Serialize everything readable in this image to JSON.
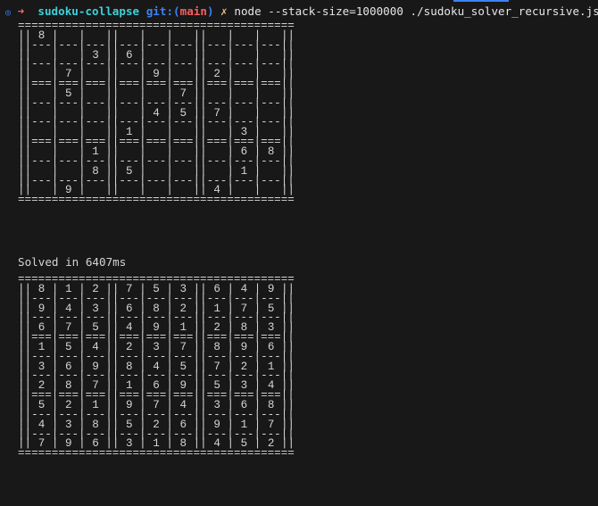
{
  "prompt": {
    "indicator": "◎",
    "arrow": "➜",
    "dir": "sudoku-collapse",
    "git_prefix": "git:(",
    "branch": "main",
    "git_suffix": ")",
    "dirty_mark": "✗",
    "command": "node --stack-size=1000000 ./sudoku_solver_recursive.js"
  },
  "puzzle": [
    [
      "8",
      "",
      "",
      "",
      "",
      "",
      "",
      "",
      ""
    ],
    [
      "",
      "",
      "3",
      "6",
      "",
      "",
      "",
      "",
      ""
    ],
    [
      "",
      "7",
      "",
      "",
      "9",
      "",
      "2",
      "",
      ""
    ],
    [
      "",
      "5",
      "",
      "",
      "",
      "7",
      "",
      "",
      ""
    ],
    [
      "",
      "",
      "",
      "",
      "4",
      "5",
      "7",
      "",
      ""
    ],
    [
      "",
      "",
      "",
      "1",
      "",
      "",
      "",
      "3",
      ""
    ],
    [
      "",
      "",
      "1",
      "",
      "",
      "",
      "",
      "6",
      "8"
    ],
    [
      "",
      "",
      "8",
      "5",
      "",
      "",
      "",
      "1",
      ""
    ],
    [
      "",
      "9",
      "",
      "",
      "",
      "",
      "4",
      "",
      ""
    ]
  ],
  "status": "Solved in 6407ms",
  "solution": [
    [
      "8",
      "1",
      "2",
      "7",
      "5",
      "3",
      "6",
      "4",
      "9"
    ],
    [
      "9",
      "4",
      "3",
      "6",
      "8",
      "2",
      "1",
      "7",
      "5"
    ],
    [
      "6",
      "7",
      "5",
      "4",
      "9",
      "1",
      "2",
      "8",
      "3"
    ],
    [
      "1",
      "5",
      "4",
      "2",
      "3",
      "7",
      "8",
      "9",
      "6"
    ],
    [
      "3",
      "6",
      "9",
      "8",
      "4",
      "5",
      "7",
      "2",
      "1"
    ],
    [
      "2",
      "8",
      "7",
      "1",
      "6",
      "9",
      "5",
      "3",
      "4"
    ],
    [
      "5",
      "2",
      "1",
      "9",
      "7",
      "4",
      "3",
      "6",
      "8"
    ],
    [
      "4",
      "3",
      "8",
      "5",
      "2",
      "6",
      "9",
      "1",
      "7"
    ],
    [
      "7",
      "9",
      "6",
      "3",
      "1",
      "8",
      "4",
      "5",
      "2"
    ]
  ]
}
